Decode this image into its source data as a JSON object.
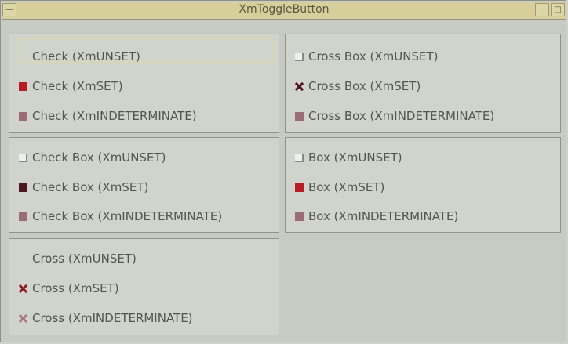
{
  "window": {
    "title": "XmToggleButton",
    "left_button": "—",
    "right_buttons": [
      "·",
      "□"
    ]
  },
  "panels": [
    {
      "rows": [
        {
          "label": "Check (XmUNSET)",
          "state": "unset_hidden"
        },
        {
          "label": "Check (XmSET)",
          "state": "set_red"
        },
        {
          "label": "Check (XmINDETERMINATE)",
          "state": "indeterminate"
        }
      ]
    },
    {
      "rows": [
        {
          "label": "Cross Box (XmUNSET)",
          "state": "unset"
        },
        {
          "label": "Cross Box (XmSET)",
          "state": "set_dark_cross"
        },
        {
          "label": "Cross Box (XmINDETERMINATE)",
          "state": "indeterminate"
        }
      ]
    },
    {
      "rows": [
        {
          "label": "Check Box (XmUNSET)",
          "state": "unset"
        },
        {
          "label": "Check Box (XmSET)",
          "state": "set_dark"
        },
        {
          "label": "Check Box (XmINDETERMINATE)",
          "state": "indeterminate"
        }
      ]
    },
    {
      "rows": [
        {
          "label": "Box (XmUNSET)",
          "state": "unset"
        },
        {
          "label": "Box (XmSET)",
          "state": "set_red"
        },
        {
          "label": "Box (XmINDETERMINATE)",
          "state": "indeterminate"
        }
      ]
    },
    {
      "rows": [
        {
          "label": "Cross (XmUNSET)",
          "state": "unset_hidden"
        },
        {
          "label": "Cross (XmSET)",
          "state": "set_cross"
        },
        {
          "label": "Cross (XmINDETERMINATE)",
          "state": "indeterminate_cross"
        }
      ]
    }
  ],
  "colors": {
    "title_bar": "#d7cf9b",
    "panel": "#d1d4cc",
    "set_red": "#b81c23",
    "set_dark": "#4e1720",
    "indeterminate": "#9a6d74"
  }
}
